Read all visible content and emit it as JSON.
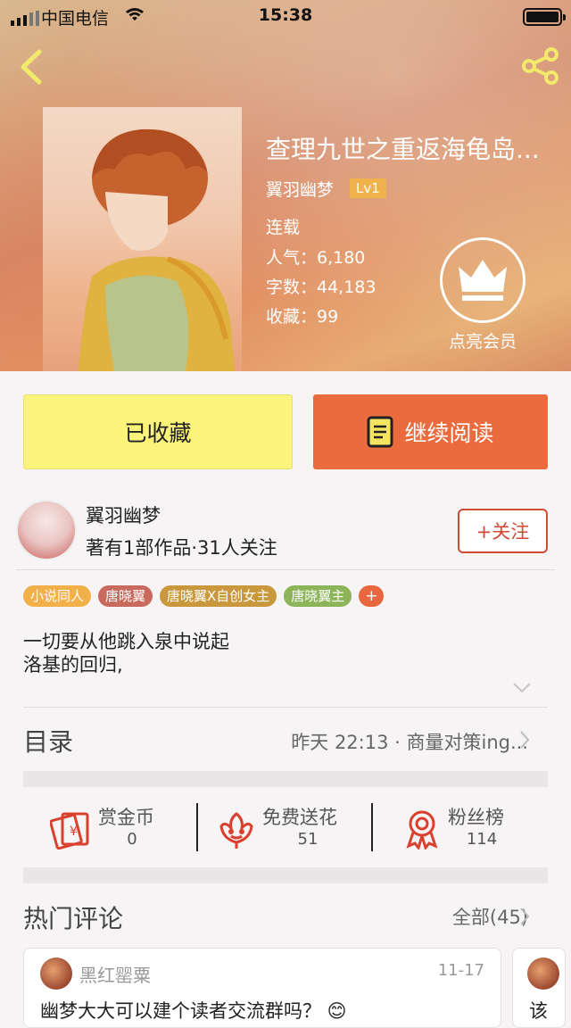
{
  "status_bar": {
    "carrier": "中国电信",
    "time": "15:38"
  },
  "book": {
    "title": "查理九世之重返海龟岛...",
    "author": "翼羽幽梦",
    "level": "Lv1",
    "status": "连载",
    "popularity": "人气：6,180",
    "word_count": "字数：44,183",
    "favorites": "收藏：99",
    "vip_label": "点亮会员"
  },
  "actions": {
    "favorited_label": "已收藏",
    "read_label": "继续阅读"
  },
  "author_info": {
    "name": "翼羽幽梦",
    "stats": "著有1部作品·31人关注",
    "follow_label": "+关注"
  },
  "tags": [
    {
      "label": "小说同人",
      "color": "#f2b04b"
    },
    {
      "label": "唐晓翼",
      "color": "#c96a5f"
    },
    {
      "label": "唐晓翼X自创女主",
      "color": "#c9983d"
    },
    {
      "label": "唐晓翼主",
      "color": "#8cb55a"
    },
    {
      "label": "+",
      "color": "#e9673f"
    }
  ],
  "summary": {
    "line1": "一切要从他跳入泉中说起",
    "line2": "洛基的回归,"
  },
  "toc": {
    "label": "目录",
    "latest": "昨天 22:13 · 商量对策ing..."
  },
  "stats": [
    {
      "label": "赏金币",
      "value": "0"
    },
    {
      "label": "免费送花",
      "value": "51"
    },
    {
      "label": "粉丝榜",
      "value": "114"
    }
  ],
  "comments": {
    "section_label": "热门评论",
    "all_label": "全部(45)",
    "items": [
      {
        "user": "黑红罂粟",
        "date": "11-17",
        "text": "幽梦大大可以建个读者交流群吗？ 😊"
      },
      {
        "text": "该"
      }
    ]
  },
  "colors": {
    "accent": "#ea6b3d",
    "favorite_bg": "#fbf37a",
    "follow": "#d14a35"
  }
}
